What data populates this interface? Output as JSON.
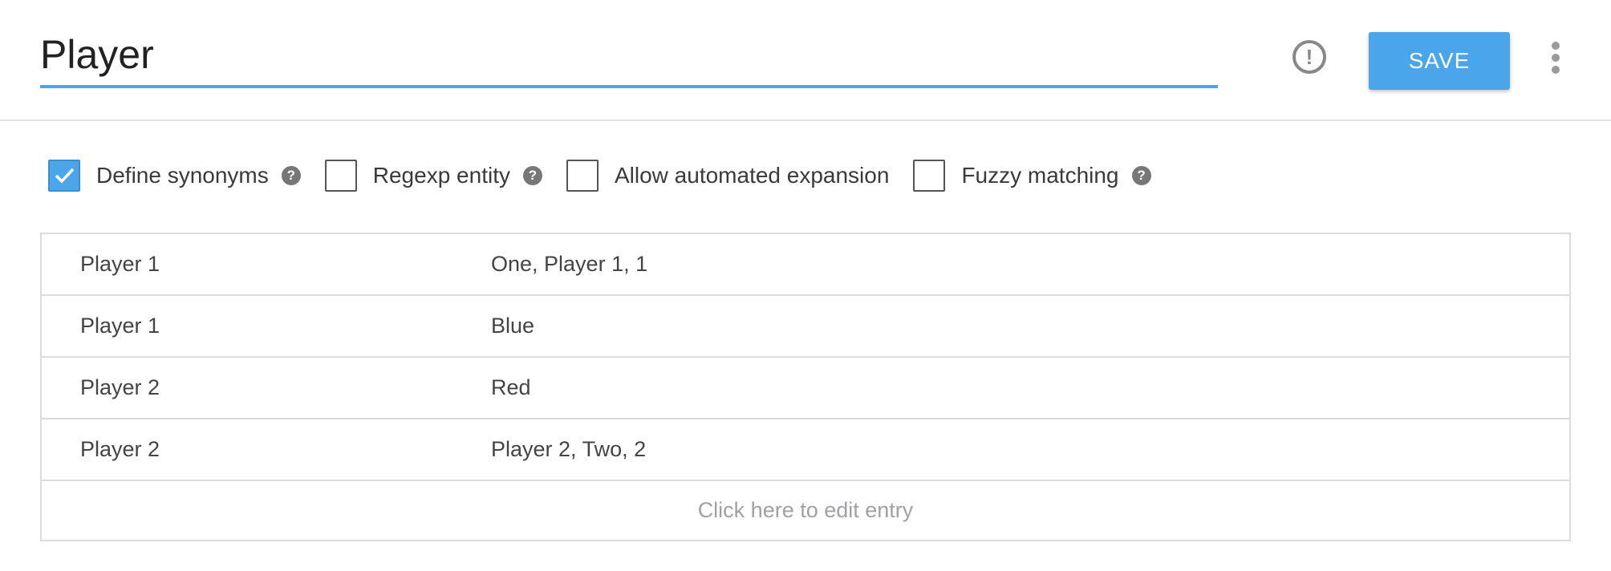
{
  "header": {
    "entity_name": "Player",
    "save_label": "SAVE"
  },
  "options": [
    {
      "label": "Define synonyms",
      "checked": true,
      "has_help": true
    },
    {
      "label": "Regexp entity",
      "checked": false,
      "has_help": true
    },
    {
      "label": "Allow automated expansion",
      "checked": false,
      "has_help": false
    },
    {
      "label": "Fuzzy matching",
      "checked": false,
      "has_help": true
    }
  ],
  "entries": [
    {
      "value": "Player 1",
      "synonyms": "One, Player 1, 1"
    },
    {
      "value": "Player 1",
      "synonyms": "Blue"
    },
    {
      "value": "Player 2",
      "synonyms": "Red"
    },
    {
      "value": "Player 2",
      "synonyms": "Player 2, Two, 2"
    }
  ],
  "add_entry_label": "Click here to edit entry",
  "colors": {
    "accent": "#4aa6e9",
    "border": "#dcdcdc",
    "muted_text": "#a0a0a8"
  }
}
